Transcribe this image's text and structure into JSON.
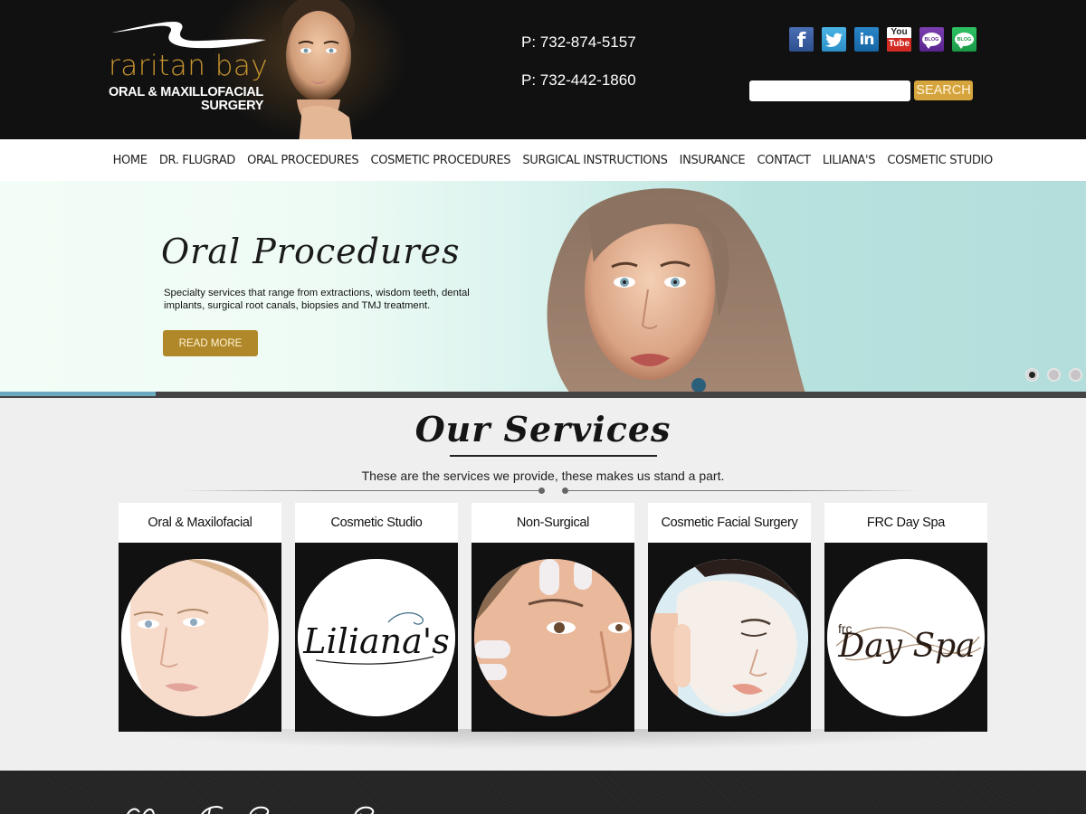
{
  "header": {
    "logo": {
      "name": "raritan bay",
      "subtitle_line1": "ORAL & MAXILLOFACIAL",
      "subtitle_line2": "SURGERY"
    },
    "phones": [
      "P: 732-874-5157",
      "P: 732-442-1860"
    ],
    "social": [
      {
        "icon": "facebook-icon",
        "label": "f"
      },
      {
        "icon": "twitter-icon",
        "label": ""
      },
      {
        "icon": "linkedin-icon",
        "label": "in"
      },
      {
        "icon": "youtube-icon",
        "label_top": "You",
        "label_bottom": "Tube"
      },
      {
        "icon": "blog-icon",
        "label": "BLOG"
      },
      {
        "icon": "blog-icon",
        "label": "BLOG"
      }
    ],
    "search": {
      "value": "",
      "placeholder": "",
      "button_label": "SEARCH"
    }
  },
  "nav": {
    "items": [
      "HOME",
      "DR. FLUGRAD",
      "ORAL PROCEDURES",
      "COSMETIC PROCEDURES",
      "SURGICAL INSTRUCTIONS",
      "INSURANCE",
      "CONTACT",
      "LILIANA'S",
      "COSMETIC STUDIO"
    ]
  },
  "slider": {
    "title": "Oral Procedures",
    "text": "Specialty services that range from extractions, wisdom teeth, dental implants, surgical root canals, biopsies and TMJ treatment.",
    "button_label": "READ MORE",
    "slide_count": 3,
    "active_slide": 1,
    "progress_fraction": 0.143
  },
  "services": {
    "title": "Our Services",
    "subtitle": "These are the services we provide, these makes us stand a part.",
    "cards": [
      {
        "title": "Oral & Maxilofacial",
        "image": "face-portrait"
      },
      {
        "title": "Cosmetic Studio",
        "image": "lilianas-logo",
        "logo_text": "Liliana's"
      },
      {
        "title": "Non-Surgical",
        "image": "gloved-hands-face"
      },
      {
        "title": "Cosmetic Facial Surgery",
        "image": "facial-mask"
      },
      {
        "title": "FRC Day Spa",
        "image": "day-spa-logo",
        "logo_small": "frc",
        "logo_text": "Day Spa"
      }
    ]
  },
  "colors": {
    "header_bg": "#111111",
    "logo_gold": "#c8952f",
    "search_button": "#d5a43d",
    "read_more": "#b08829",
    "progress": "#6aa9c0",
    "card_body": "#111111"
  }
}
